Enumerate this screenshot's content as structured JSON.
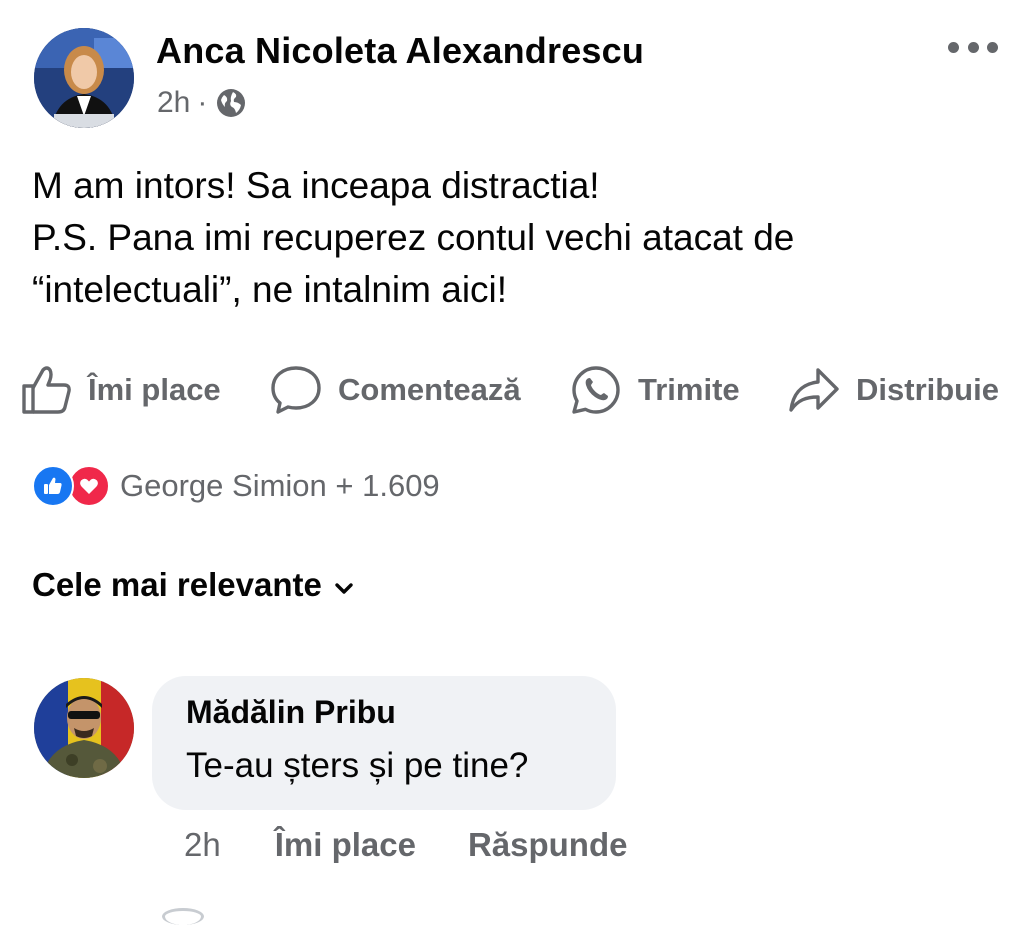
{
  "post": {
    "author": "Anca Nicoleta Alexandrescu",
    "time": "2h",
    "separator": "·",
    "privacy_icon": "globe-icon",
    "menu_icon": "more-icon",
    "text_lines": [
      "M am intors! Sa inceapa distractia!",
      "P.S. Pana imi recuperez contul vechi atacat de",
      "“intelectuali”, ne intalnim aici!"
    ]
  },
  "actions": {
    "like": "Îmi place",
    "comment": "Comentează",
    "send": "Trimite",
    "share": "Distribuie"
  },
  "reactions": {
    "icons": [
      "like-reaction-icon",
      "love-reaction-icon"
    ],
    "summary": "George Simion + 1.609"
  },
  "comments_sort": {
    "label": "Cele mai relevante"
  },
  "comment": {
    "author": "Mădălin Pribu",
    "text": "Te-au șters și pe tine?",
    "time": "2h",
    "like": "Îmi place",
    "reply": "Răspunde"
  },
  "colors": {
    "text": "#050505",
    "secondary": "#65676b",
    "bubble": "#f0f2f5",
    "like_blue": "#1877f2",
    "love_red": "#f0284a"
  }
}
